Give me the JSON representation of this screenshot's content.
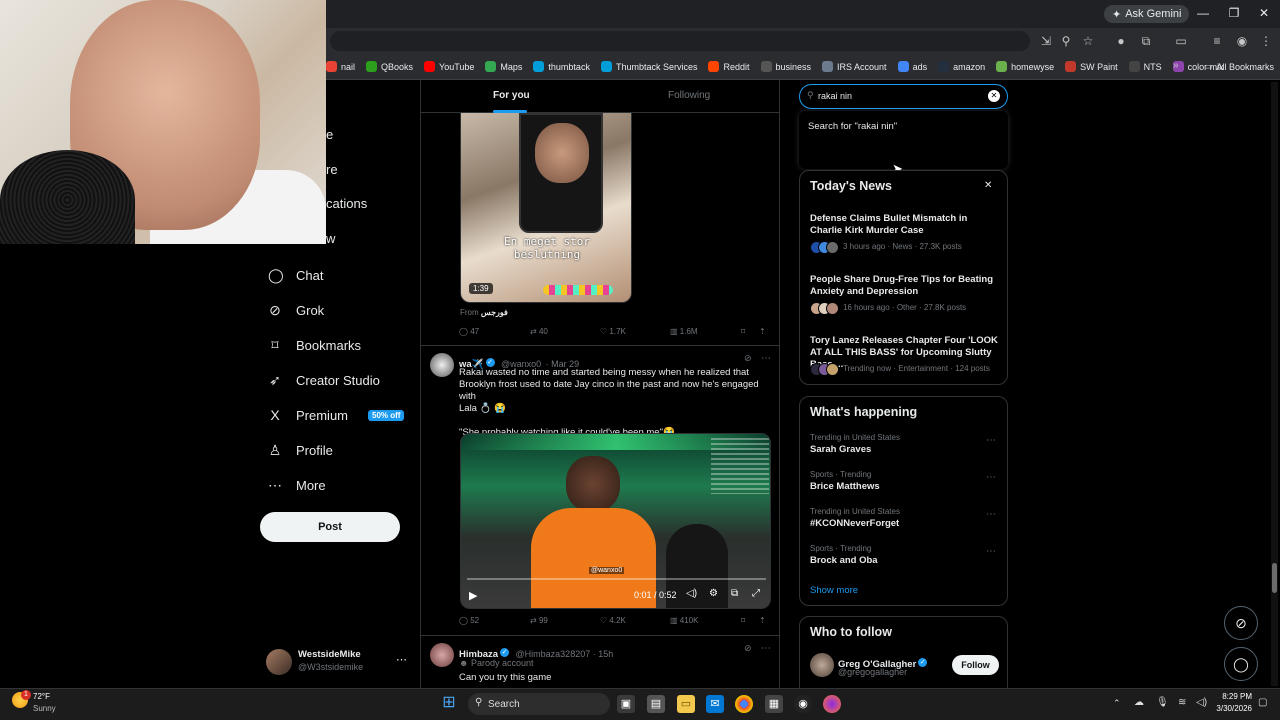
{
  "browser": {
    "gemini_label": "Ask Gemini",
    "bookmarks": [
      {
        "label": "nail",
        "icon": "gmail-icon",
        "color": "#ea4335"
      },
      {
        "label": "QBooks",
        "icon": "qbooks-icon",
        "color": "#2ca01c"
      },
      {
        "label": "YouTube",
        "icon": "youtube-icon",
        "color": "#ff0000"
      },
      {
        "label": "Maps",
        "icon": "maps-icon",
        "color": "#34a853"
      },
      {
        "label": "thumbtack",
        "icon": "thumbtack-icon",
        "color": "#009fd9"
      },
      {
        "label": "Thumbtack Services",
        "icon": "thumbtack-icon",
        "color": "#009fd9"
      },
      {
        "label": "Reddit",
        "icon": "reddit-icon",
        "color": "#ff4500"
      },
      {
        "label": "business",
        "icon": "google-icon",
        "color": "#555555"
      },
      {
        "label": "IRS Account",
        "icon": "irs-icon",
        "color": "#6b7a8f"
      },
      {
        "label": "ads",
        "icon": "ads-icon",
        "color": "#4285f4"
      },
      {
        "label": "amazon",
        "icon": "amazon-icon",
        "color": "#232f3e"
      },
      {
        "label": "homewyse",
        "icon": "homewyse-icon",
        "color": "#6ab04c"
      },
      {
        "label": "SW Paint",
        "icon": "sw-icon",
        "color": "#c0392b"
      },
      {
        "label": "NTS",
        "icon": "nts-icon",
        "color": "#444444"
      },
      {
        "label": "color mix",
        "icon": "colormix-icon",
        "color": "#8e44ad"
      }
    ],
    "all_bookmarks": "All Bookmarks"
  },
  "nav": {
    "fragments": [
      "e",
      "re",
      "cations",
      "w"
    ],
    "items": [
      {
        "label": "Chat",
        "icon": "chat-icon",
        "glyph": "◯"
      },
      {
        "label": "Grok",
        "icon": "grok-icon",
        "glyph": "⊘"
      },
      {
        "label": "Bookmarks",
        "icon": "bookmark-icon",
        "glyph": "⌑"
      },
      {
        "label": "Creator Studio",
        "icon": "rocket-icon",
        "glyph": "➶"
      },
      {
        "label": "Premium",
        "icon": "x-logo-icon",
        "glyph": "X"
      },
      {
        "label": "Profile",
        "icon": "profile-icon",
        "glyph": "♙"
      },
      {
        "label": "More",
        "icon": "more-icon",
        "glyph": "⋯"
      }
    ],
    "premium_badge": "50% off",
    "post_label": "Post",
    "account_name": "WestsideMike",
    "account_handle": "@W3stsidemike"
  },
  "feed": {
    "tabs": [
      "For you",
      "Following"
    ],
    "tweet1": {
      "video_time": "1:39",
      "caption_line1": "En meget stor",
      "caption_line2": "beslutning",
      "from_label": "From",
      "from_name": "فورجس",
      "replies": "47",
      "reposts": "40",
      "likes": "1.7K",
      "views": "1.6M"
    },
    "tweet2": {
      "name": "wa✈️",
      "handle": "@wanxo0",
      "date": "· Mar 29",
      "text_lines": [
        "Rakai wasted no time and started being messy when he realized that",
        "Brooklyn frost used to date Jay cinco in the past and now he's engaged with",
        "Lala 💍 😭"
      ],
      "quote": "\"She probably watching like it could've been me\"😭",
      "video_progress": "0:01 / 0:52",
      "watermark": "@wanxo0",
      "replies": "52",
      "reposts": "99",
      "likes": "4.2K",
      "views": "410K"
    },
    "tweet3": {
      "name": "Himbaza",
      "handle": "@Himbaza328207 · 15h",
      "badge": "Parody account",
      "text": "Can you try this game"
    }
  },
  "search": {
    "query": "rakai nin",
    "suggestion": "Search for \"rakai nin\""
  },
  "news": {
    "title": "Today's News",
    "items": [
      {
        "headline": "Defense Claims Bullet Mismatch in Charlie Kirk Murder Case",
        "meta": "3 hours ago · News · 27.3K posts"
      },
      {
        "headline": "People Share Drug-Free Tips for Beating Anxiety and Depression",
        "meta": "16 hours ago · Other · 27.8K posts"
      },
      {
        "headline": "Tory Lanez Releases Chapter Four 'LOOK AT ALL THIS BASS' for Upcoming Slutty Bass ...",
        "meta": "Trending now · Entertainment · 124 posts"
      }
    ]
  },
  "happening": {
    "title": "What's happening",
    "trends": [
      {
        "context": "Trending in United States",
        "name": "Sarah Graves"
      },
      {
        "context": "Sports · Trending",
        "name": "Brice Matthews"
      },
      {
        "context": "Trending in United States",
        "name": "#KCONNeverForget"
      },
      {
        "context": "Sports · Trending",
        "name": "Brock and Oba"
      }
    ],
    "show_more": "Show more"
  },
  "who_to_follow": {
    "title": "Who to follow",
    "name": "Greg O'Gallagher",
    "handle": "@gregogallagher",
    "follow_label": "Follow"
  },
  "taskbar": {
    "temp": "72°F",
    "weather": "Sunny",
    "search": "Search",
    "time": "8:29 PM",
    "date": "3/30/2026",
    "notification_count": "1"
  }
}
